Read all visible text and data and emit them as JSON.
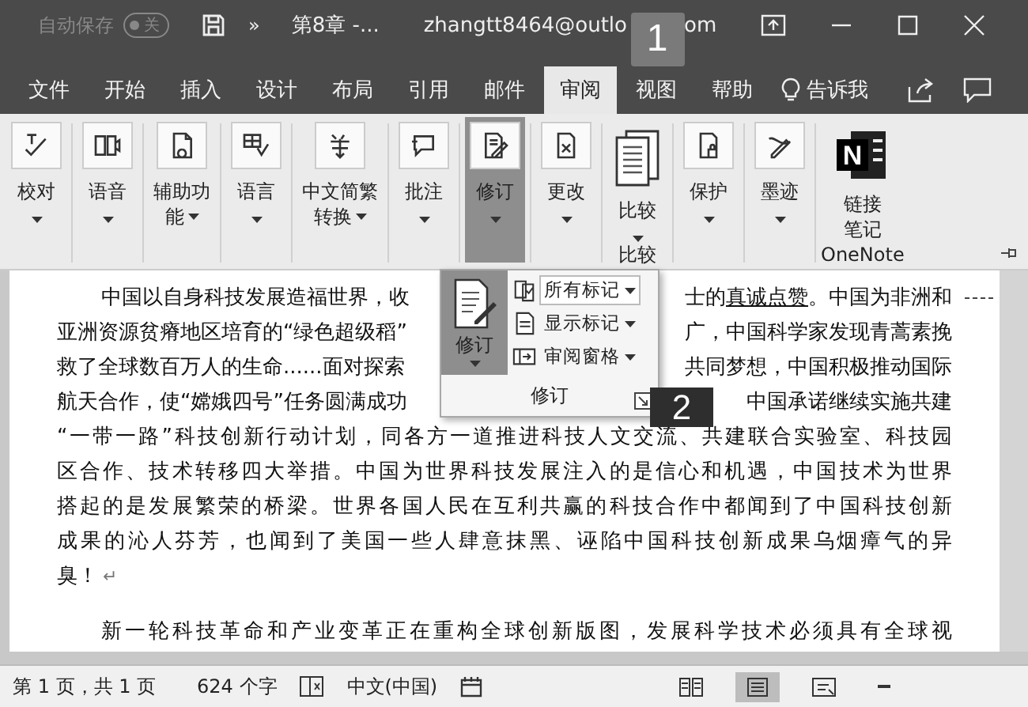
{
  "title_bar": {
    "autosave_label": "自动保存",
    "autosave_toggle": {
      "state_label": "关",
      "on": false
    },
    "more_symbol": "»",
    "document_title": "第8章 -...",
    "account_left": "zhangtt8464@outlo",
    "account_right": "om"
  },
  "callouts": [
    {
      "number": "1"
    },
    {
      "number": "2"
    }
  ],
  "tabs": [
    {
      "label": "文件",
      "selected": false
    },
    {
      "label": "开始",
      "selected": false
    },
    {
      "label": "插入",
      "selected": false
    },
    {
      "label": "设计",
      "selected": false
    },
    {
      "label": "布局",
      "selected": false
    },
    {
      "label": "引用",
      "selected": false
    },
    {
      "label": "邮件",
      "selected": false
    },
    {
      "label": "审阅",
      "selected": true
    },
    {
      "label": "视图",
      "selected": false
    },
    {
      "label": "帮助",
      "selected": false
    }
  ],
  "tell_me": "告诉我",
  "ribbon": {
    "buttons": [
      {
        "lines": [
          "校对"
        ],
        "dropdown": true,
        "selected": false,
        "kind": "tile"
      },
      {
        "lines": [
          "语音"
        ],
        "dropdown": true,
        "selected": false,
        "kind": "tile"
      },
      {
        "lines": [
          "辅助功",
          "能"
        ],
        "dropdown": true,
        "selected": false,
        "kind": "tile"
      },
      {
        "lines": [
          "语言"
        ],
        "dropdown": true,
        "selected": false,
        "kind": "tile"
      },
      {
        "lines": [
          "中文简繁",
          "转换"
        ],
        "dropdown": true,
        "selected": false,
        "kind": "tile"
      },
      {
        "lines": [
          "批注"
        ],
        "dropdown": true,
        "selected": false,
        "kind": "tile"
      },
      {
        "lines": [
          "修订"
        ],
        "dropdown": true,
        "selected": true,
        "kind": "tile"
      },
      {
        "lines": [
          "更改"
        ],
        "dropdown": true,
        "selected": false,
        "kind": "tile"
      },
      {
        "lines": [
          "比较"
        ],
        "dropdown": true,
        "selected": false,
        "kind": "large",
        "group_label": "比较"
      },
      {
        "lines": [
          "保护"
        ],
        "dropdown": true,
        "selected": false,
        "kind": "tile"
      },
      {
        "lines": [
          "墨迹"
        ],
        "dropdown": true,
        "selected": false,
        "kind": "tile"
      },
      {
        "lines": [
          "链接",
          "笔记"
        ],
        "dropdown": false,
        "selected": false,
        "kind": "logo",
        "logo_letter": "N",
        "group_label": "OneNote"
      }
    ]
  },
  "revision_menu": {
    "button": {
      "label": "修订",
      "selected": true
    },
    "items": [
      {
        "label": "所有标记",
        "kind": "field"
      },
      {
        "label": "显示标记",
        "kind": "menu"
      },
      {
        "label": "审阅窗格",
        "kind": "menu"
      }
    ],
    "group_label": "修订"
  },
  "document": {
    "paragraphs": [
      {
        "lines": [
          {
            "kind": "split",
            "left": "中国以自身科技发展造福世界，收",
            "right": [
              {
                "text": "士的"
              },
              {
                "text": "真诚点赞",
                "underlined": true
              },
              {
                "text": "。中国为非洲和"
              }
            ],
            "changed": true
          },
          {
            "kind": "split",
            "left": "亚洲资源贫瘠地区培育的“绿色超级稻”",
            "right": [
              {
                "text": "广，中国科学家发现青蒿素挽"
              }
            ]
          },
          {
            "kind": "split",
            "left": "救了全球数百万人的生命......面对探索",
            "right": [
              {
                "text": "共同梦想，中国积极推动国际"
              }
            ]
          },
          {
            "kind": "split",
            "left": "航天合作，使“嫦娥四号”任务圆满成功",
            "right": [
              {
                "text": "中国承诺继续实施共建"
              }
            ]
          },
          {
            "kind": "full",
            "text": "“一带一路”科技创新行动计划，同各方一道推进科技人文交流、共建联合实验室、科技园"
          },
          {
            "kind": "full",
            "text": "区合作、技术转移四大举措。中国为世界科技发展注入的是信心和机遇，中国技术为世界"
          },
          {
            "kind": "full",
            "text": "搭起的是发展繁荣的桥梁。世界各国人民在互利共赢的科技合作中都闻到了中国科技创新"
          },
          {
            "kind": "full",
            "text": "成果的沁人芬芳，也闻到了美国一些人肆意抹黑、诬陷中国科技创新成果乌烟瘴气的异"
          },
          {
            "kind": "end",
            "text": "臭！",
            "mark": "↵"
          }
        ]
      },
      {
        "lines": [
          {
            "kind": "full",
            "text": "新一轮科技革命和产业变革正在重构全球创新版图，发展科学技术必须具有全球视"
          }
        ]
      }
    ]
  },
  "status_bar": {
    "page": "第 1 页，共 1 页",
    "words": "624 个字",
    "language": "中文(中国)",
    "views": [
      {
        "selected": false
      },
      {
        "selected": true
      },
      {
        "selected": false
      }
    ]
  }
}
